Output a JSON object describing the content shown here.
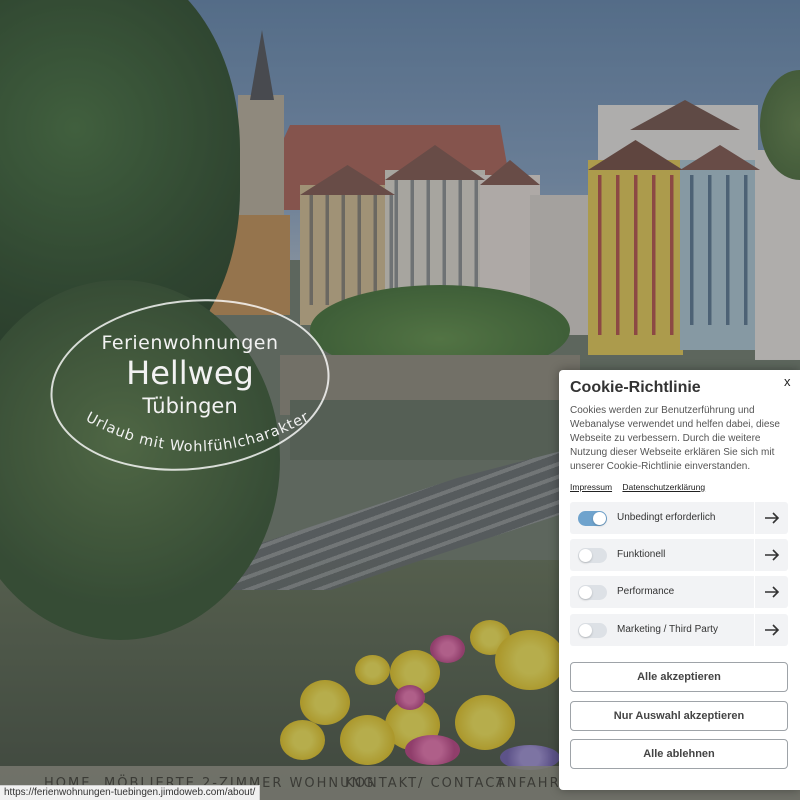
{
  "logo": {
    "line1": "Ferienwohnungen",
    "line2": "Hellweg",
    "line3": "Tübingen",
    "slogan": "Urlaub mit Wohlfühlcharakter"
  },
  "nav": {
    "items": [
      "HOME",
      "MÖBLIERTE 2-ZIMMER WOHNUNG",
      "KONTAKT/ CONTACT",
      "ANFAHRT/"
    ]
  },
  "status_bar": {
    "url": "https://ferienwohnungen-tuebingen.jimdoweb.com/about/"
  },
  "cookie": {
    "title": "Cookie-Richtlinie",
    "close": "x",
    "text": "Cookies werden zur Benutzerführung und Webanalyse verwendet und helfen dabei, diese Webseite zu verbessern. Durch die weitere Nutzung dieser Webseite erklären Sie sich mit unserer Cookie-Richtlinie einverstanden.",
    "links": [
      "Impressum",
      "Datenschutzerklärung"
    ],
    "categories": [
      {
        "label": "Unbedingt erforderlich",
        "enabled": true
      },
      {
        "label": "Funktionell",
        "enabled": false
      },
      {
        "label": "Performance",
        "enabled": false
      },
      {
        "label": "Marketing / Third Party",
        "enabled": false
      }
    ],
    "buttons": {
      "accept_all": "Alle akzeptieren",
      "accept_selection": "Nur Auswahl akzeptieren",
      "reject_all": "Alle ablehnen"
    },
    "toggle_on_color": "#6fa3cd"
  }
}
